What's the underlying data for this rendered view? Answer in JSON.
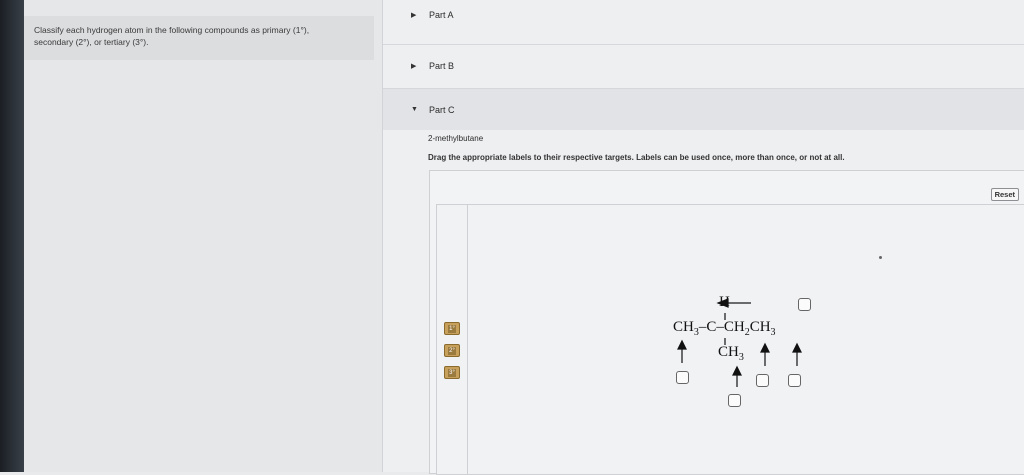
{
  "instructions": {
    "line1": "Classify each hydrogen atom in the following compounds as primary (1°),",
    "line2": "secondary (2°), or tertiary (3°)."
  },
  "parts": [
    {
      "label": "Part A",
      "expanded": false
    },
    {
      "label": "Part B",
      "expanded": false
    },
    {
      "label": "Part C",
      "expanded": true
    }
  ],
  "part_c": {
    "compound": "2-methylbutane",
    "drag_instructions": "Drag the appropriate labels to their respective targets. Labels can be used once, more than once, or not at all.",
    "reset_label": "Reset",
    "labels": [
      "1°",
      "2°",
      "3°"
    ],
    "molecule": {
      "h_atom": "H",
      "main_chain": {
        "left": "CH",
        "left_sub": "3",
        "dash1": "–",
        "center": "C",
        "dash2": "–",
        "right1": "CH",
        "right1_sub": "2",
        "right2": "CH",
        "right2_sub": "3"
      },
      "branch": {
        "text": "CH",
        "sub": "3"
      }
    }
  },
  "icons": {
    "collapsed": "caret-right-icon",
    "expanded": "caret-down-icon"
  },
  "colors": {
    "label_chip": "#c7a05b"
  }
}
